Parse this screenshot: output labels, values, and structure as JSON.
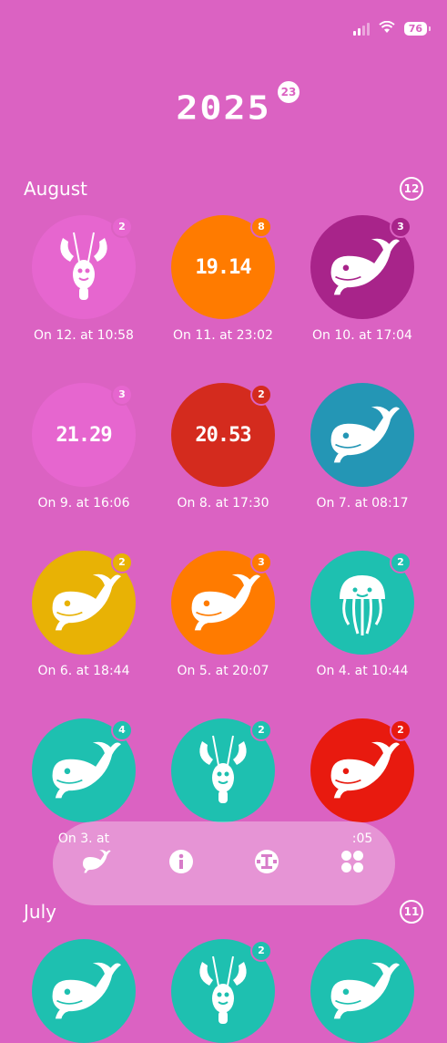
{
  "status_bar": {
    "battery": "76"
  },
  "year": {
    "title": "2025",
    "badge": "23"
  },
  "months": [
    {
      "name": "August",
      "count": "12",
      "items": [
        {
          "caption": "On 12. at 10:58",
          "badge": "2",
          "badge_color": "#E666CF",
          "color": "#E666CF",
          "icon": "lobster-icon"
        },
        {
          "caption": "On 11. at 23:02",
          "badge": "8",
          "badge_color": "#FF7B00",
          "color": "#FF7B00",
          "time": "19.14"
        },
        {
          "caption": "On 10. at 17:04",
          "badge": "3",
          "badge_color": "#A8248A",
          "color": "#A8248A",
          "icon": "whale-icon"
        },
        {
          "caption": "On 9. at 16:06",
          "badge": "3",
          "badge_color": "#E666CF",
          "color": "#E666CF",
          "time": "21.29"
        },
        {
          "caption": "On 8. at 17:30",
          "badge": "2",
          "badge_color": "#D42B1E",
          "color": "#D42B1E",
          "time": "20.53"
        },
        {
          "caption": "On 7. at 08:17",
          "badge": "",
          "badge_color": "",
          "color": "#2496B5",
          "icon": "whale-icon"
        },
        {
          "caption": "On 6. at 18:44",
          "badge": "2",
          "badge_color": "#E8B205",
          "color": "#E8B205",
          "icon": "whale-icon"
        },
        {
          "caption": "On 5. at 20:07",
          "badge": "3",
          "badge_color": "#FF7B00",
          "color": "#FF7B00",
          "icon": "whale-icon"
        },
        {
          "caption": "On 4. at 10:44",
          "badge": "2",
          "badge_color": "#1EC0B0",
          "color": "#1EC0B0",
          "icon": "jellyfish-icon"
        },
        {
          "caption": "On 3. at",
          "badge": "4",
          "badge_color": "#1EC0B0",
          "color": "#1EC0B0",
          "icon": "whale-icon"
        },
        {
          "caption": "",
          "badge": "2",
          "badge_color": "#1EC0B0",
          "color": "#1EC0B0",
          "icon": "lobster-icon"
        },
        {
          "caption": ":05",
          "badge": "2",
          "badge_color": "#E81A0F",
          "color": "#E81A0F",
          "icon": "whale-icon"
        }
      ]
    },
    {
      "name": "July",
      "count": "11",
      "items": [
        {
          "caption": "",
          "badge": "",
          "badge_color": "",
          "color": "#1EC0B0",
          "icon": "whale-icon"
        },
        {
          "caption": "",
          "badge": "2",
          "badge_color": "#1EC0B0",
          "color": "#1EC0B0",
          "icon": "lobster-icon"
        },
        {
          "caption": "",
          "badge": "",
          "badge_color": "",
          "color": "#1EC0B0",
          "icon": "whale-icon"
        }
      ]
    }
  ],
  "nav": [
    {
      "icon": "whale-icon"
    },
    {
      "icon": "info-icon"
    },
    {
      "icon": "timer-icon"
    },
    {
      "icon": "grid-icon"
    }
  ]
}
